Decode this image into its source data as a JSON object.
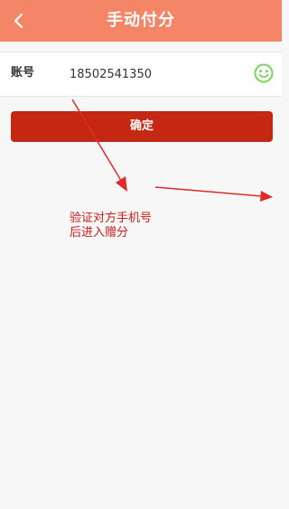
{
  "header": {
    "title": "手动付分",
    "back_icon": "chevron-left-icon",
    "background_color": "#f48566"
  },
  "account": {
    "label": "账号",
    "value": "18502541350",
    "verify_icon": "smiley-face-icon",
    "verify_icon_color": "#7bd35a"
  },
  "confirm_button": {
    "label": "确定",
    "color": "#c52812"
  },
  "annotation": {
    "line1": "验证对方手机号",
    "line2": "后进入赠分",
    "color": "#cc1b1b"
  }
}
